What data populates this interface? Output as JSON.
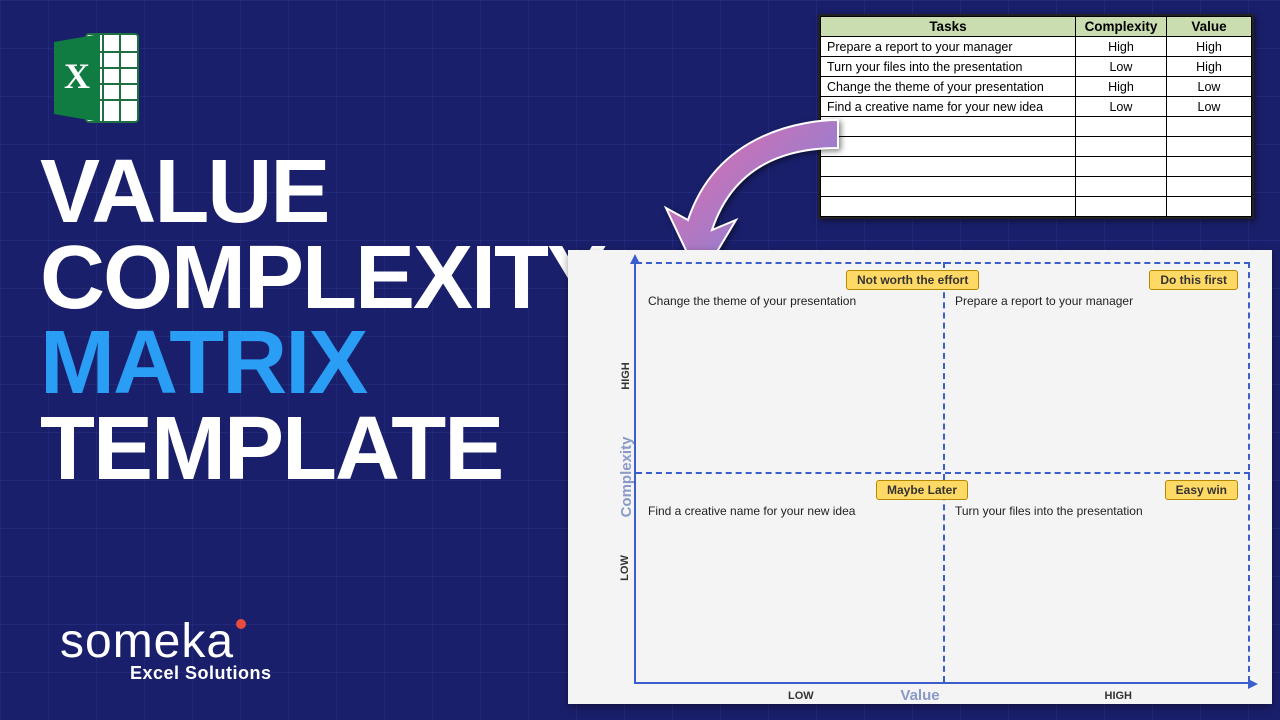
{
  "title": {
    "line1": "VALUE",
    "line2": "COMPLEXITY",
    "line3": "MATRIX",
    "line4": "TEMPLATE"
  },
  "brand": {
    "name": "someka",
    "sub": "Excel Solutions"
  },
  "table": {
    "headers": [
      "Tasks",
      "Complexity",
      "Value"
    ],
    "rows": [
      {
        "task": "Prepare a report to your manager",
        "complexity": "High",
        "value": "High"
      },
      {
        "task": "Turn your files into the presentation",
        "complexity": "Low",
        "value": "High"
      },
      {
        "task": "Change the theme of your presentation",
        "complexity": "High",
        "value": "Low"
      },
      {
        "task": "Find a creative name for your new idea",
        "complexity": "Low",
        "value": "Low"
      }
    ],
    "blank_rows": 5
  },
  "chart": {
    "y_axis": "Complexity",
    "x_axis": "Value",
    "y_ticks": {
      "high": "HIGH",
      "low": "LOW"
    },
    "x_ticks": {
      "low": "LOW",
      "high": "HIGH"
    },
    "quadrants": {
      "top_left": {
        "label": "Not worth the effort",
        "item": "Change the theme of your presentation"
      },
      "top_right": {
        "label": "Do this first",
        "item": "Prepare a report to your manager"
      },
      "bot_left": {
        "label": "Maybe Later",
        "item": "Find a creative name for your new idea"
      },
      "bot_right": {
        "label": "Easy win",
        "item": "Turn your files into the presentation"
      }
    }
  },
  "chart_data": {
    "type": "scatter",
    "title": "Value Complexity Matrix",
    "xlabel": "Value",
    "ylabel": "Complexity",
    "x_categories": [
      "Low",
      "High"
    ],
    "y_categories": [
      "Low",
      "High"
    ],
    "quadrant_labels": {
      "low_value_high_complexity": "Not worth the effort",
      "high_value_high_complexity": "Do this first",
      "low_value_low_complexity": "Maybe Later",
      "high_value_low_complexity": "Easy win"
    },
    "points": [
      {
        "name": "Prepare a report to your manager",
        "value": "High",
        "complexity": "High"
      },
      {
        "name": "Turn your files into the presentation",
        "value": "High",
        "complexity": "Low"
      },
      {
        "name": "Change the theme of your presentation",
        "value": "Low",
        "complexity": "High"
      },
      {
        "name": "Find a creative name for your new idea",
        "value": "Low",
        "complexity": "Low"
      }
    ]
  }
}
